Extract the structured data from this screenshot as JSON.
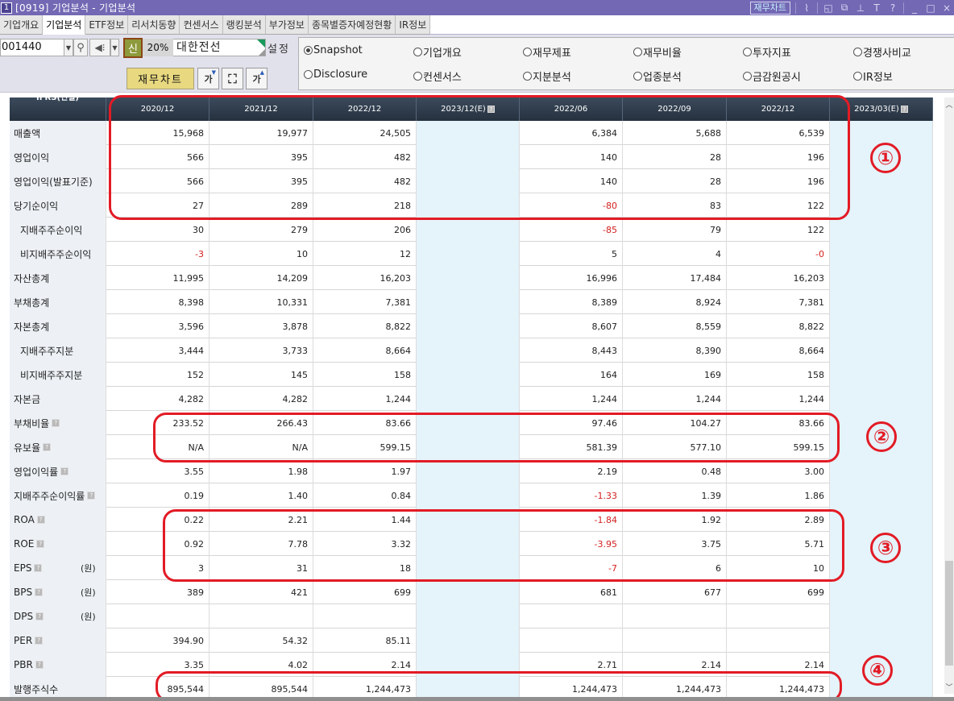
{
  "window": {
    "badge": "1",
    "title": "[0919] 기업분석 - 기업분석",
    "chart_button": "재무차트",
    "icons": [
      "chart-icon",
      "layout-icon",
      "window-icon",
      "pin-icon",
      "text-icon",
      "help-icon",
      "minimize-icon",
      "maximize-icon",
      "close-icon"
    ],
    "icon_glyphs": {
      "chart": "⌇",
      "layout": "◱",
      "window": "⧉",
      "pin": "📌",
      "text": "T",
      "help": "?",
      "minimize": "_",
      "maximize": "□",
      "close": "×"
    }
  },
  "tabs": [
    {
      "label": "기업개요",
      "active": false
    },
    {
      "label": "기업분석",
      "active": true
    },
    {
      "label": "ETF정보",
      "active": false
    },
    {
      "label": "리서치동향",
      "active": false
    },
    {
      "label": "컨센서스",
      "active": false
    },
    {
      "label": "랭킹분석",
      "active": false
    },
    {
      "label": "부가정보",
      "active": false
    },
    {
      "label": "종목별증자예정현황",
      "active": false
    },
    {
      "label": "IR정보",
      "active": false
    }
  ],
  "toolbar": {
    "stock_code": "001440",
    "new_badge": "신",
    "margin_rate": "20%",
    "stock_name": "대한전선",
    "settings_label": "설정",
    "fin_chart_button": "재무차트",
    "font_down": "가",
    "fit": "⌗",
    "font_up": "가",
    "radios": [
      {
        "label": "Snapshot",
        "checked": true
      },
      {
        "label": "기업개요",
        "checked": false
      },
      {
        "label": "재무제표",
        "checked": false
      },
      {
        "label": "재무비율",
        "checked": false
      },
      {
        "label": "투자지표",
        "checked": false
      },
      {
        "label": "경쟁사비교",
        "checked": false
      },
      {
        "label": "Disclosure",
        "checked": false
      },
      {
        "label": "컨센서스",
        "checked": false
      },
      {
        "label": "지분분석",
        "checked": false
      },
      {
        "label": "업종분석",
        "checked": false
      },
      {
        "label": "금감원공시",
        "checked": false
      },
      {
        "label": "IR정보",
        "checked": false
      }
    ]
  },
  "table": {
    "corner_label": "IFRS(연결)",
    "columns": [
      {
        "label": "2020/12",
        "estimate": false,
        "help": false
      },
      {
        "label": "2021/12",
        "estimate": false,
        "help": false
      },
      {
        "label": "2022/12",
        "estimate": false,
        "help": false
      },
      {
        "label": "2023/12(E)",
        "estimate": true,
        "help": true
      },
      {
        "label": "2022/06",
        "estimate": false,
        "help": false
      },
      {
        "label": "2022/09",
        "estimate": false,
        "help": false
      },
      {
        "label": "2022/12",
        "estimate": false,
        "help": false
      },
      {
        "label": "2023/03(E)",
        "estimate": true,
        "help": true
      }
    ],
    "rows": [
      {
        "label": "매출액",
        "indent": false,
        "help": false,
        "unit": "",
        "values": [
          "15,968",
          "19,977",
          "24,505",
          "",
          "6,384",
          "5,688",
          "6,539",
          ""
        ]
      },
      {
        "label": "영업이익",
        "indent": false,
        "help": false,
        "unit": "",
        "values": [
          "566",
          "395",
          "482",
          "",
          "140",
          "28",
          "196",
          ""
        ]
      },
      {
        "label": "영업이익(발표기준)",
        "indent": false,
        "help": false,
        "unit": "",
        "values": [
          "566",
          "395",
          "482",
          "",
          "140",
          "28",
          "196",
          ""
        ]
      },
      {
        "label": "당기순이익",
        "indent": false,
        "help": false,
        "unit": "",
        "values": [
          "27",
          "289",
          "218",
          "",
          "-80",
          "83",
          "122",
          ""
        ]
      },
      {
        "label": "지배주주순이익",
        "indent": true,
        "help": false,
        "unit": "",
        "values": [
          "30",
          "279",
          "206",
          "",
          "-85",
          "79",
          "122",
          ""
        ]
      },
      {
        "label": "비지배주주순이익",
        "indent": true,
        "help": false,
        "unit": "",
        "values": [
          "-3",
          "10",
          "12",
          "",
          "5",
          "4",
          "-0",
          ""
        ]
      },
      {
        "label": "자산총계",
        "indent": false,
        "help": false,
        "unit": "",
        "values": [
          "11,995",
          "14,209",
          "16,203",
          "",
          "16,996",
          "17,484",
          "16,203",
          ""
        ]
      },
      {
        "label": "부채총계",
        "indent": false,
        "help": false,
        "unit": "",
        "values": [
          "8,398",
          "10,331",
          "7,381",
          "",
          "8,389",
          "8,924",
          "7,381",
          ""
        ]
      },
      {
        "label": "자본총계",
        "indent": false,
        "help": false,
        "unit": "",
        "values": [
          "3,596",
          "3,878",
          "8,822",
          "",
          "8,607",
          "8,559",
          "8,822",
          ""
        ]
      },
      {
        "label": "지배주주지분",
        "indent": true,
        "help": false,
        "unit": "",
        "values": [
          "3,444",
          "3,733",
          "8,664",
          "",
          "8,443",
          "8,390",
          "8,664",
          ""
        ]
      },
      {
        "label": "비지배주주지분",
        "indent": true,
        "help": false,
        "unit": "",
        "values": [
          "152",
          "145",
          "158",
          "",
          "164",
          "169",
          "158",
          ""
        ]
      },
      {
        "label": "자본금",
        "indent": false,
        "help": false,
        "unit": "",
        "values": [
          "4,282",
          "4,282",
          "1,244",
          "",
          "1,244",
          "1,244",
          "1,244",
          ""
        ]
      },
      {
        "label": "부채비율",
        "indent": false,
        "help": true,
        "unit": "",
        "values": [
          "233.52",
          "266.43",
          "83.66",
          "",
          "97.46",
          "104.27",
          "83.66",
          ""
        ]
      },
      {
        "label": "유보율",
        "indent": false,
        "help": true,
        "unit": "",
        "values": [
          "N/A",
          "N/A",
          "599.15",
          "",
          "581.39",
          "577.10",
          "599.15",
          ""
        ]
      },
      {
        "label": "영업이익률",
        "indent": false,
        "help": true,
        "unit": "",
        "values": [
          "3.55",
          "1.98",
          "1.97",
          "",
          "2.19",
          "0.48",
          "3.00",
          ""
        ]
      },
      {
        "label": "지배주주순이익률",
        "indent": false,
        "help": true,
        "unit": "",
        "values": [
          "0.19",
          "1.40",
          "0.84",
          "",
          "-1.33",
          "1.39",
          "1.86",
          ""
        ]
      },
      {
        "label": "ROA",
        "indent": false,
        "help": true,
        "unit": "",
        "values": [
          "0.22",
          "2.21",
          "1.44",
          "",
          "-1.84",
          "1.92",
          "2.89",
          ""
        ]
      },
      {
        "label": "ROE",
        "indent": false,
        "help": true,
        "unit": "",
        "values": [
          "0.92",
          "7.78",
          "3.32",
          "",
          "-3.95",
          "3.75",
          "5.71",
          ""
        ]
      },
      {
        "label": "EPS",
        "indent": false,
        "help": true,
        "unit": "(원)",
        "values": [
          "3",
          "31",
          "18",
          "",
          "-7",
          "6",
          "10",
          ""
        ]
      },
      {
        "label": "BPS",
        "indent": false,
        "help": true,
        "unit": "(원)",
        "values": [
          "389",
          "421",
          "699",
          "",
          "681",
          "677",
          "699",
          ""
        ]
      },
      {
        "label": "DPS",
        "indent": false,
        "help": true,
        "unit": "(원)",
        "values": [
          "",
          "",
          "",
          "",
          "",
          "",
          "",
          ""
        ]
      },
      {
        "label": "PER",
        "indent": false,
        "help": true,
        "unit": "",
        "values": [
          "394.90",
          "54.32",
          "85.11",
          "",
          "",
          "",
          "",
          ""
        ]
      },
      {
        "label": "PBR",
        "indent": false,
        "help": true,
        "unit": "",
        "values": [
          "3.35",
          "4.02",
          "2.14",
          "",
          "2.71",
          "2.14",
          "2.14",
          ""
        ]
      },
      {
        "label": "발행주식수",
        "indent": false,
        "help": false,
        "unit": "",
        "values": [
          "895,544",
          "895,544",
          "1,244,473",
          "",
          "1,244,473",
          "1,244,473",
          "1,244,473",
          ""
        ]
      }
    ]
  },
  "annotations": [
    {
      "label": "①"
    },
    {
      "label": "②"
    },
    {
      "label": "③"
    },
    {
      "label": "④"
    }
  ],
  "colors": {
    "titlebar": "#7268b4",
    "header": "#2e3a4a",
    "negative": "#d42020",
    "annotation": "#e21b25",
    "estimate_column": "#e5f3fa"
  }
}
